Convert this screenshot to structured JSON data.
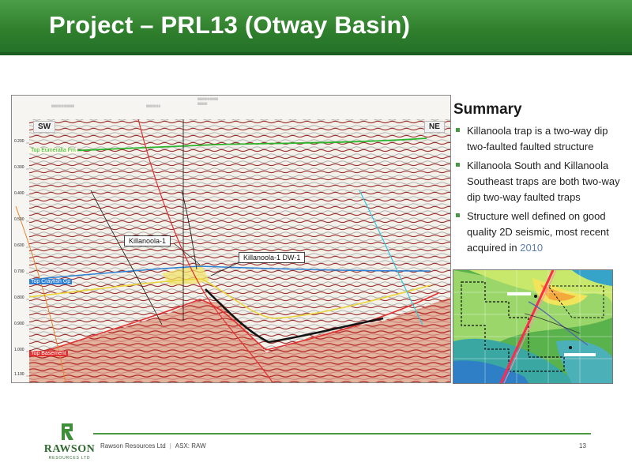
{
  "slide": {
    "title": "Project – PRL13 (Otway Basin)",
    "colors": {
      "title_bar": "#2f7f2c",
      "accent_green": "#4a9a43",
      "highlight_text": "#5a7fb0"
    }
  },
  "seismic": {
    "direction_left": "SW",
    "direction_right": "NE",
    "callouts": [
      "Killanoola-1",
      "Killanoola-1 DW-1"
    ],
    "horizons": [
      {
        "name": "Top Eumeralla Fm",
        "color": "#2bb52b"
      },
      {
        "name": "Top Crayfish Gp",
        "color": "#2b7fd4"
      },
      {
        "name": "Top Basement",
        "color": "#e03030"
      }
    ],
    "time_labels": [
      "0.200",
      "0.300",
      "0.400",
      "0.500",
      "0.600",
      "0.700",
      "0.800",
      "0.900",
      "1.000",
      "1.100"
    ]
  },
  "summary": {
    "heading": "Summary",
    "bullets": [
      {
        "text": "Killanoola trap is a two-way dip two-faulted faulted structure"
      },
      {
        "text": "Killanoola South and Killanoola Southeast traps are both two-way dip two-way faulted traps"
      },
      {
        "text": "Structure well defined on good quality 2D seismic, most recent acquired in ",
        "highlight": "2010"
      }
    ]
  },
  "footer": {
    "logo_name": "RAWSON",
    "logo_sub": "RESOURCES LTD",
    "company": "Rawson Resources Ltd",
    "ticker": "ASX: RAW",
    "page_number": "13"
  }
}
